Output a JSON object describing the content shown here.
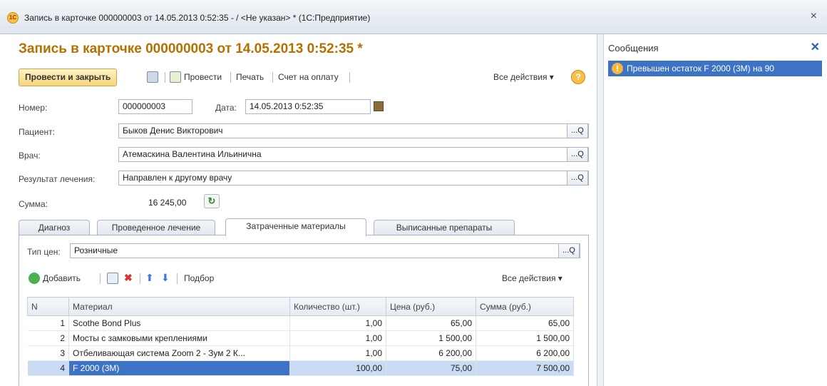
{
  "window": {
    "title": "Запись в карточке 000000003 от 14.05.2013 0:52:35 - / <Не указан> * (1С:Предприятие)",
    "logo_text": "1С",
    "close_glyph": "×"
  },
  "document": {
    "title": "Запись в карточке 000000003 от 14.05.2013 0:52:35 *"
  },
  "toolbar": {
    "post_close_label": "Провести и закрыть",
    "post_label": "Провести",
    "print_label": "Печать",
    "invoice_label": "Счет на оплату",
    "all_actions_label": "Все действия ▾",
    "help_label": "?"
  },
  "form": {
    "number_label": "Номер:",
    "number_value": "000000003",
    "date_label": "Дата:",
    "date_value": "14.05.2013  0:52:35",
    "patient_label": "Пациент:",
    "patient_value": "Быков Денис Викторович",
    "doctor_label": "Врач:",
    "doctor_value": "Атемаскина Валентина Ильинична",
    "result_label": "Результат лечения:",
    "result_value": "Направлен к другому врачу",
    "sum_label": "Сумма:",
    "sum_value": "16 245,00",
    "pick_glyph": "...",
    "search_glyph": "Q"
  },
  "tabs": [
    {
      "label": "Диагноз"
    },
    {
      "label": "Проведенное лечение"
    },
    {
      "label": "Затраченные материалы"
    },
    {
      "label": "Выписанные препараты"
    }
  ],
  "materials": {
    "price_type_label": "Тип цен:",
    "price_type_value": "Розничные",
    "add_label": "Добавить",
    "selection_label": "Подбор",
    "all_actions_label": "Все действия ▾",
    "columns": [
      "N",
      "Материал",
      "Количество (шт.)",
      "Цена (руб.)",
      "Сумма (руб.)"
    ],
    "rows": [
      {
        "n": "1",
        "material": "Scothe Bond Plus",
        "qty": "1,00",
        "price": "65,00",
        "sum": "65,00"
      },
      {
        "n": "2",
        "material": "Мосты с замковыми креплениями",
        "qty": "1,00",
        "price": "1 500,00",
        "sum": "1 500,00"
      },
      {
        "n": "3",
        "material": "Отбеливающая система Zoom 2 - Зум 2 К...",
        "qty": "1,00",
        "price": "6 200,00",
        "sum": "6 200,00"
      },
      {
        "n": "4",
        "material": "F 2000 (3M)",
        "qty": "100,00",
        "price": "75,00",
        "sum": "7 500,00"
      }
    ]
  },
  "messages": {
    "title": "Сообщения",
    "close_glyph": "✕",
    "items": [
      {
        "text": "Превышен остаток F 2000 (3М) на 90"
      }
    ],
    "warning_glyph": "!"
  },
  "colors": {
    "doc_title": "#b47000",
    "selection": "#3d73c4",
    "row_highlight": "#c9dcf3"
  }
}
